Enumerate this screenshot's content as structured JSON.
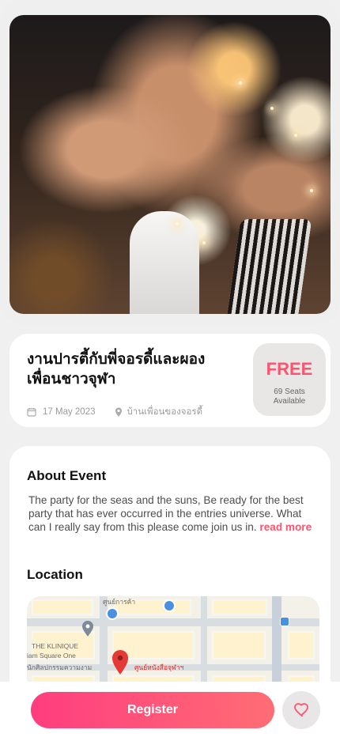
{
  "event": {
    "title": "งานปารตี้กับพี่จอรดี้และผองเพื่อนชาวจุฬา",
    "date": "17 May 2023",
    "location": "บ้านเพื่อนของจอรดี้",
    "price": "FREE",
    "seats_line1": "69 Seats",
    "seats_line2": "Available"
  },
  "about": {
    "title": "About Event",
    "text": "The party for the seas and the suns, Be ready for the best party that has ever occurred in the entries universe. What can I really say from this please come join us in.",
    "read_more": "read more"
  },
  "location": {
    "title": "Location",
    "map_labels": [
      "ศูนย์การค้า",
      "THE KLINIQUE",
      "iam Square One",
      "นักศิลปกรรมความงาม",
      "ศูนย์หนังสือจุฬาฯ"
    ]
  },
  "actions": {
    "register": "Register"
  },
  "icons": {
    "calendar": "calendar-icon",
    "location": "location-pin-icon",
    "heart": "heart-icon"
  },
  "colors": {
    "accent": "#ff5470",
    "register_start": "#ff3d7f",
    "register_end": "#ff6d74",
    "muted": "#9b9b9b"
  }
}
